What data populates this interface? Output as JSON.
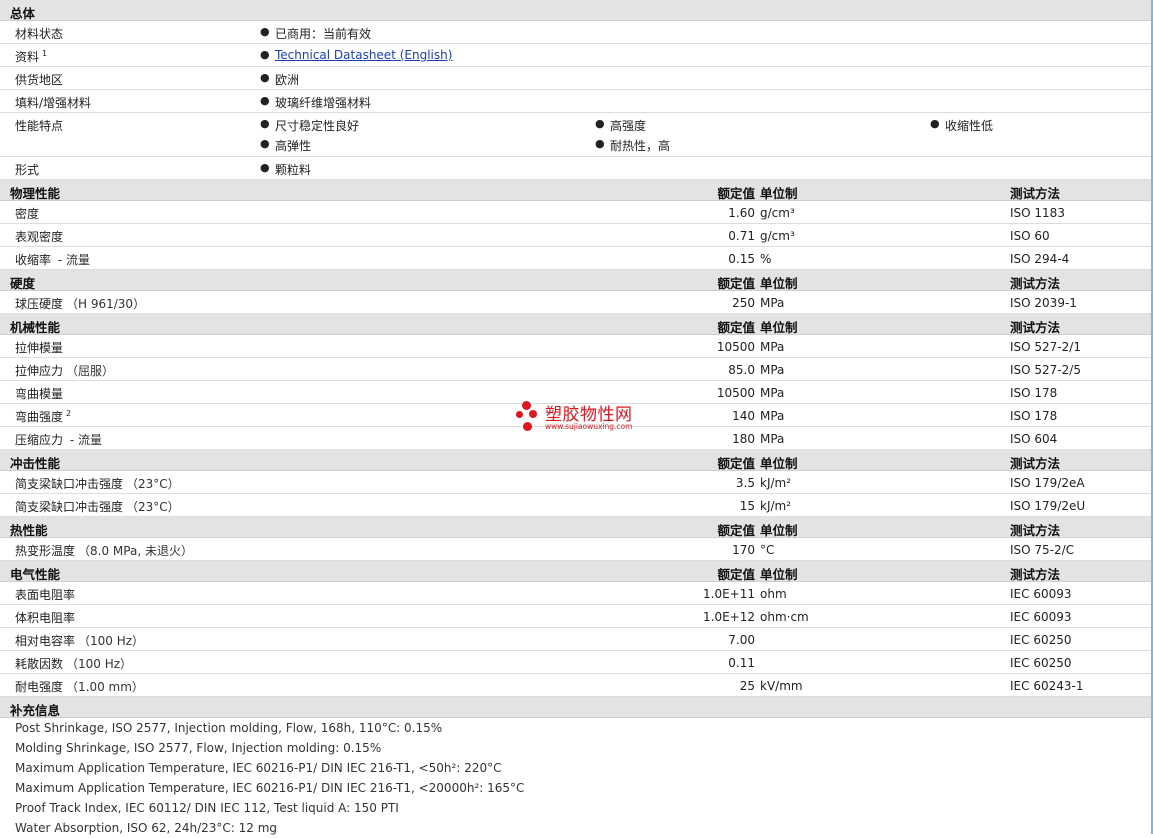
{
  "general": {
    "title": "总体",
    "status": {
      "label": "材料状态",
      "value": "已商用：当前有效"
    },
    "resources": {
      "label": "资料",
      "sup": "1",
      "link": "Technical Datasheet (English)"
    },
    "availability": {
      "label": "供货地区",
      "value": "欧洲"
    },
    "filler": {
      "label": "填料/增强材料",
      "value": "玻璃纤维增强材料"
    },
    "features": {
      "label": "性能特点",
      "items": [
        "尺寸稳定性良好",
        "高强度",
        "收缩性低",
        "高弹性",
        "耐热性，高"
      ]
    },
    "form": {
      "label": "形式",
      "value": "颗粒料"
    }
  },
  "columns": {
    "value": "额定值",
    "unit": "单位制",
    "method": "测试方法"
  },
  "physical": {
    "title": "物理性能",
    "rows": [
      {
        "label": "密度",
        "cond": "",
        "sup": "",
        "value": "1.60",
        "unit": "g/cm³",
        "method": "ISO 1183"
      },
      {
        "label": "表观密度",
        "cond": "",
        "sup": "",
        "value": "0.71",
        "unit": "g/cm³",
        "method": "ISO 60"
      },
      {
        "label": "收缩率",
        "cond": " - 流量",
        "sup": "",
        "value": "0.15",
        "unit": "%",
        "method": "ISO 294-4"
      }
    ]
  },
  "hardness": {
    "title": "硬度",
    "rows": [
      {
        "label": "球压硬度",
        "cond": "（H 961/30）",
        "sup": "",
        "value": "250",
        "unit": "MPa",
        "method": "ISO 2039-1"
      }
    ]
  },
  "mechanical": {
    "title": "机械性能",
    "rows": [
      {
        "label": "拉伸模量",
        "cond": "",
        "sup": "",
        "value": "10500",
        "unit": "MPa",
        "method": "ISO 527-2/1"
      },
      {
        "label": "拉伸应力",
        "cond": "（屈服）",
        "sup": "",
        "value": "85.0",
        "unit": "MPa",
        "method": "ISO 527-2/5"
      },
      {
        "label": "弯曲模量",
        "cond": "",
        "sup": "",
        "value": "10500",
        "unit": "MPa",
        "method": "ISO 178"
      },
      {
        "label": "弯曲强度",
        "cond": "",
        "sup": "2",
        "value": "140",
        "unit": "MPa",
        "method": "ISO 178"
      },
      {
        "label": "压缩应力",
        "cond": " - 流量",
        "sup": "",
        "value": "180",
        "unit": "MPa",
        "method": "ISO 604"
      }
    ]
  },
  "impact": {
    "title": "冲击性能",
    "rows": [
      {
        "label": "简支梁缺口冲击强度",
        "cond": "（23°C）",
        "sup": "",
        "value": "3.5",
        "unit": "kJ/m²",
        "method": "ISO 179/2eA"
      },
      {
        "label": "简支梁缺口冲击强度",
        "cond": "（23°C）",
        "sup": "",
        "value": "15",
        "unit": "kJ/m²",
        "method": "ISO 179/2eU"
      }
    ]
  },
  "thermal": {
    "title": "热性能",
    "rows": [
      {
        "label": "热变形温度",
        "cond": "（8.0 MPa, 未退火）",
        "sup": "",
        "value": "170",
        "unit": "°C",
        "method": "ISO 75-2/C"
      }
    ]
  },
  "electrical": {
    "title": "电气性能",
    "rows": [
      {
        "label": "表面电阻率",
        "cond": "",
        "sup": "",
        "value": "1.0E+11",
        "unit": "ohm",
        "method": "IEC 60093"
      },
      {
        "label": "体积电阻率",
        "cond": "",
        "sup": "",
        "value": "1.0E+12",
        "unit": "ohm·cm",
        "method": "IEC 60093"
      },
      {
        "label": "相对电容率",
        "cond": "（100 Hz）",
        "sup": "",
        "value": "7.00",
        "unit": "",
        "method": "IEC 60250"
      },
      {
        "label": "耗散因数",
        "cond": "（100 Hz）",
        "sup": "",
        "value": "0.11",
        "unit": "",
        "method": "IEC 60250"
      },
      {
        "label": "耐电强度",
        "cond": "（1.00 mm）",
        "sup": "",
        "value": "25",
        "unit": "kV/mm",
        "method": "IEC 60243-1"
      }
    ]
  },
  "supplemental": {
    "title": "补充信息",
    "lines": [
      "Post Shrinkage, ISO 2577, Injection molding, Flow, 168h, 110°C: 0.15%",
      "Molding Shrinkage, ISO 2577, Flow, Injection molding: 0.15%",
      "Maximum Application Temperature, IEC 60216-P1/ DIN IEC 216-T1, <50h²: 220°C",
      "Maximum Application Temperature, IEC 60216-P1/ DIN IEC 216-T1, <20000h²: 165°C",
      "Proof Track Index, IEC 60112/ DIN IEC 112, Test liquid A: 150 PTI",
      "Water Absorption, ISO 62, 24h/23°C: 12 mg"
    ]
  },
  "watermark": {
    "name": "塑胶物性网",
    "url": "www.sujiaowuxing.com",
    "color": "#e0161f"
  }
}
